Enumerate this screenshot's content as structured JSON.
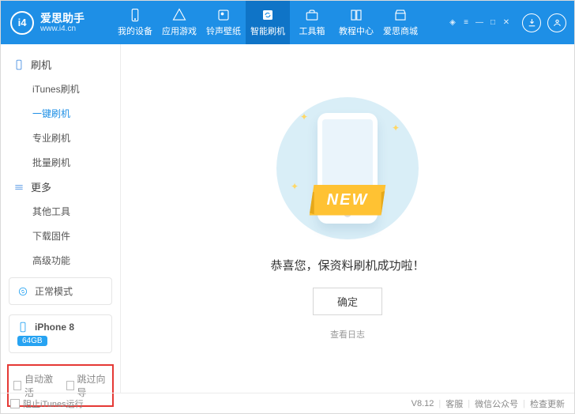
{
  "brand": {
    "title": "爱思助手",
    "url": "www.i4.cn",
    "logo_text": "i4"
  },
  "nav": {
    "items": [
      {
        "label": "我的设备"
      },
      {
        "label": "应用游戏"
      },
      {
        "label": "铃声壁纸"
      },
      {
        "label": "智能刷机"
      },
      {
        "label": "工具箱"
      },
      {
        "label": "教程中心"
      },
      {
        "label": "爱思商城"
      }
    ],
    "active_index": 3
  },
  "sidebar": {
    "groups": [
      {
        "title": "刷机",
        "items": [
          "iTunes刷机",
          "一键刷机",
          "专业刷机",
          "批量刷机"
        ],
        "active_item": 1
      },
      {
        "title": "更多",
        "items": [
          "其他工具",
          "下载固件",
          "高级功能"
        ]
      }
    ],
    "mode": {
      "label": "正常模式"
    },
    "device": {
      "name": "iPhone 8",
      "storage": "64GB"
    },
    "options": [
      {
        "label": "自动激活",
        "checked": false
      },
      {
        "label": "跳过向导",
        "checked": false
      }
    ]
  },
  "main": {
    "ribbon": "NEW",
    "message": "恭喜您，保资料刷机成功啦！",
    "ok": "确定",
    "view_log": "查看日志"
  },
  "status": {
    "block_itunes": "阻止iTunes运行",
    "version": "V8.12",
    "support": "客服",
    "wechat": "微信公众号",
    "update": "检查更新"
  }
}
